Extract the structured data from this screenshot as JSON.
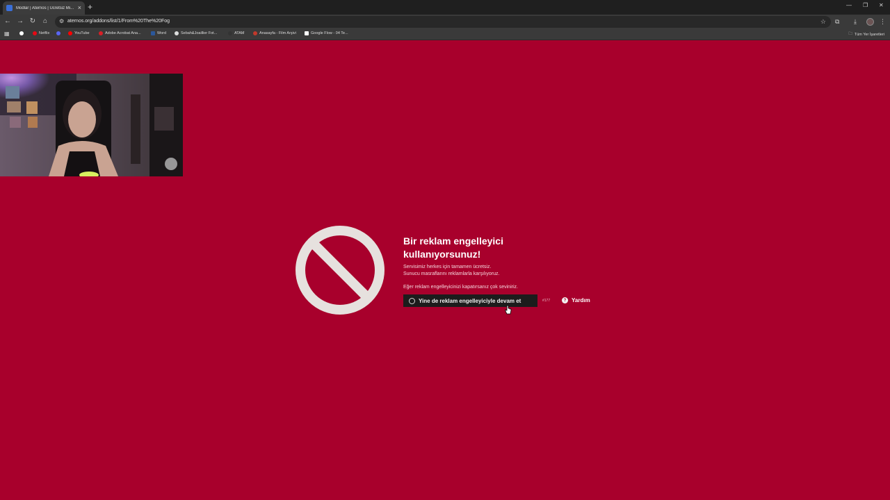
{
  "browser": {
    "tab_title": "Modlar | Aternos | Ücretsiz Mi...",
    "url": "aternos.org/addons/list/1/From%20The%20Fog",
    "bookmarks": [
      {
        "label": "Netflix",
        "color": "#e50914"
      },
      {
        "label": "YouTube",
        "color": "#ff0000"
      },
      {
        "label": "Adobe Acrobat Ana...",
        "color": "#d81f26"
      },
      {
        "label": "Word",
        "color": "#2b579a"
      },
      {
        "label": "Sebah&Joaillier Fot...",
        "color": "#dddddd"
      },
      {
        "label": "ATAM",
        "color": "#333333"
      },
      {
        "label": "Anasayfa - Film Arşivi",
        "color": "#c0392b"
      },
      {
        "label": "Google Flow - 04 Te...",
        "color": "#ffffff"
      }
    ],
    "all_bookmarks_label": "Tüm Yer İşaretleri"
  },
  "notice": {
    "title": "Bir reklam engelleyici kullanıyorsunuz!",
    "line1": "Servisimiz herkes için tamamen ücretsiz.",
    "line2": "Sunucu masraflarını reklamlarla karşılıyoruz.",
    "line3": "Eğer reklam engelleyicinizi kapatırsanız çok seviniriz.",
    "continue_label": "Yine de reklam engelleyiciyle devam et",
    "code": "#177",
    "help_label": "Yardım"
  },
  "colors": {
    "background": "#a8002c",
    "button": "#1c1c1c",
    "ban_icon": "#e6e1de"
  }
}
